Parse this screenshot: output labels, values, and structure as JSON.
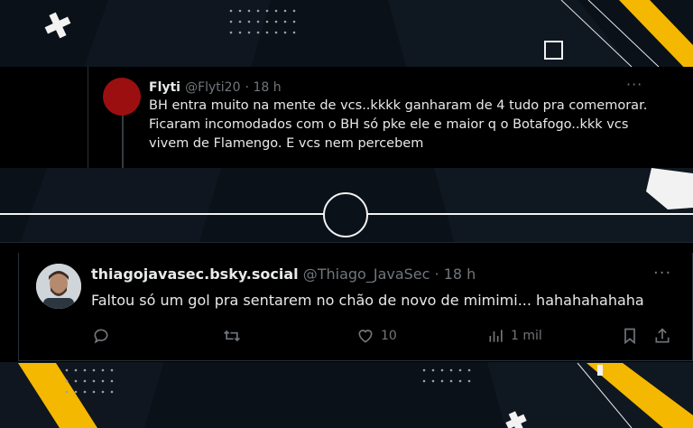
{
  "tweet1": {
    "name": "Flyti",
    "handle": "@Flyti20",
    "time": "· 18 h",
    "more": "···",
    "text": "BH entra muito na mente de vcs..kkkk ganharam de 4  tudo pra comemorar. Ficaram incomodados com o BH só pke ele e maior q o Botafogo..kkk vcs vivem de Flamengo. E vcs nem percebem"
  },
  "tweet2": {
    "name": "thiagojavasec.bsky.social",
    "handle": "@Thiago_JavaSec",
    "time": "· 18 h",
    "more": "···",
    "text": "Faltou só um gol pra sentarem no chão de novo de mimimi... hahahahahaha",
    "likes": "10",
    "views": "1 mil"
  },
  "icons": [
    "reply-icon",
    "retweet-icon",
    "like-icon",
    "views-icon",
    "bookmark-icon",
    "share-icon"
  ],
  "colors": {
    "accent_yellow": "#f5b800",
    "background": "#0b1118",
    "text": "#e7e9ea",
    "muted": "#71767b"
  }
}
